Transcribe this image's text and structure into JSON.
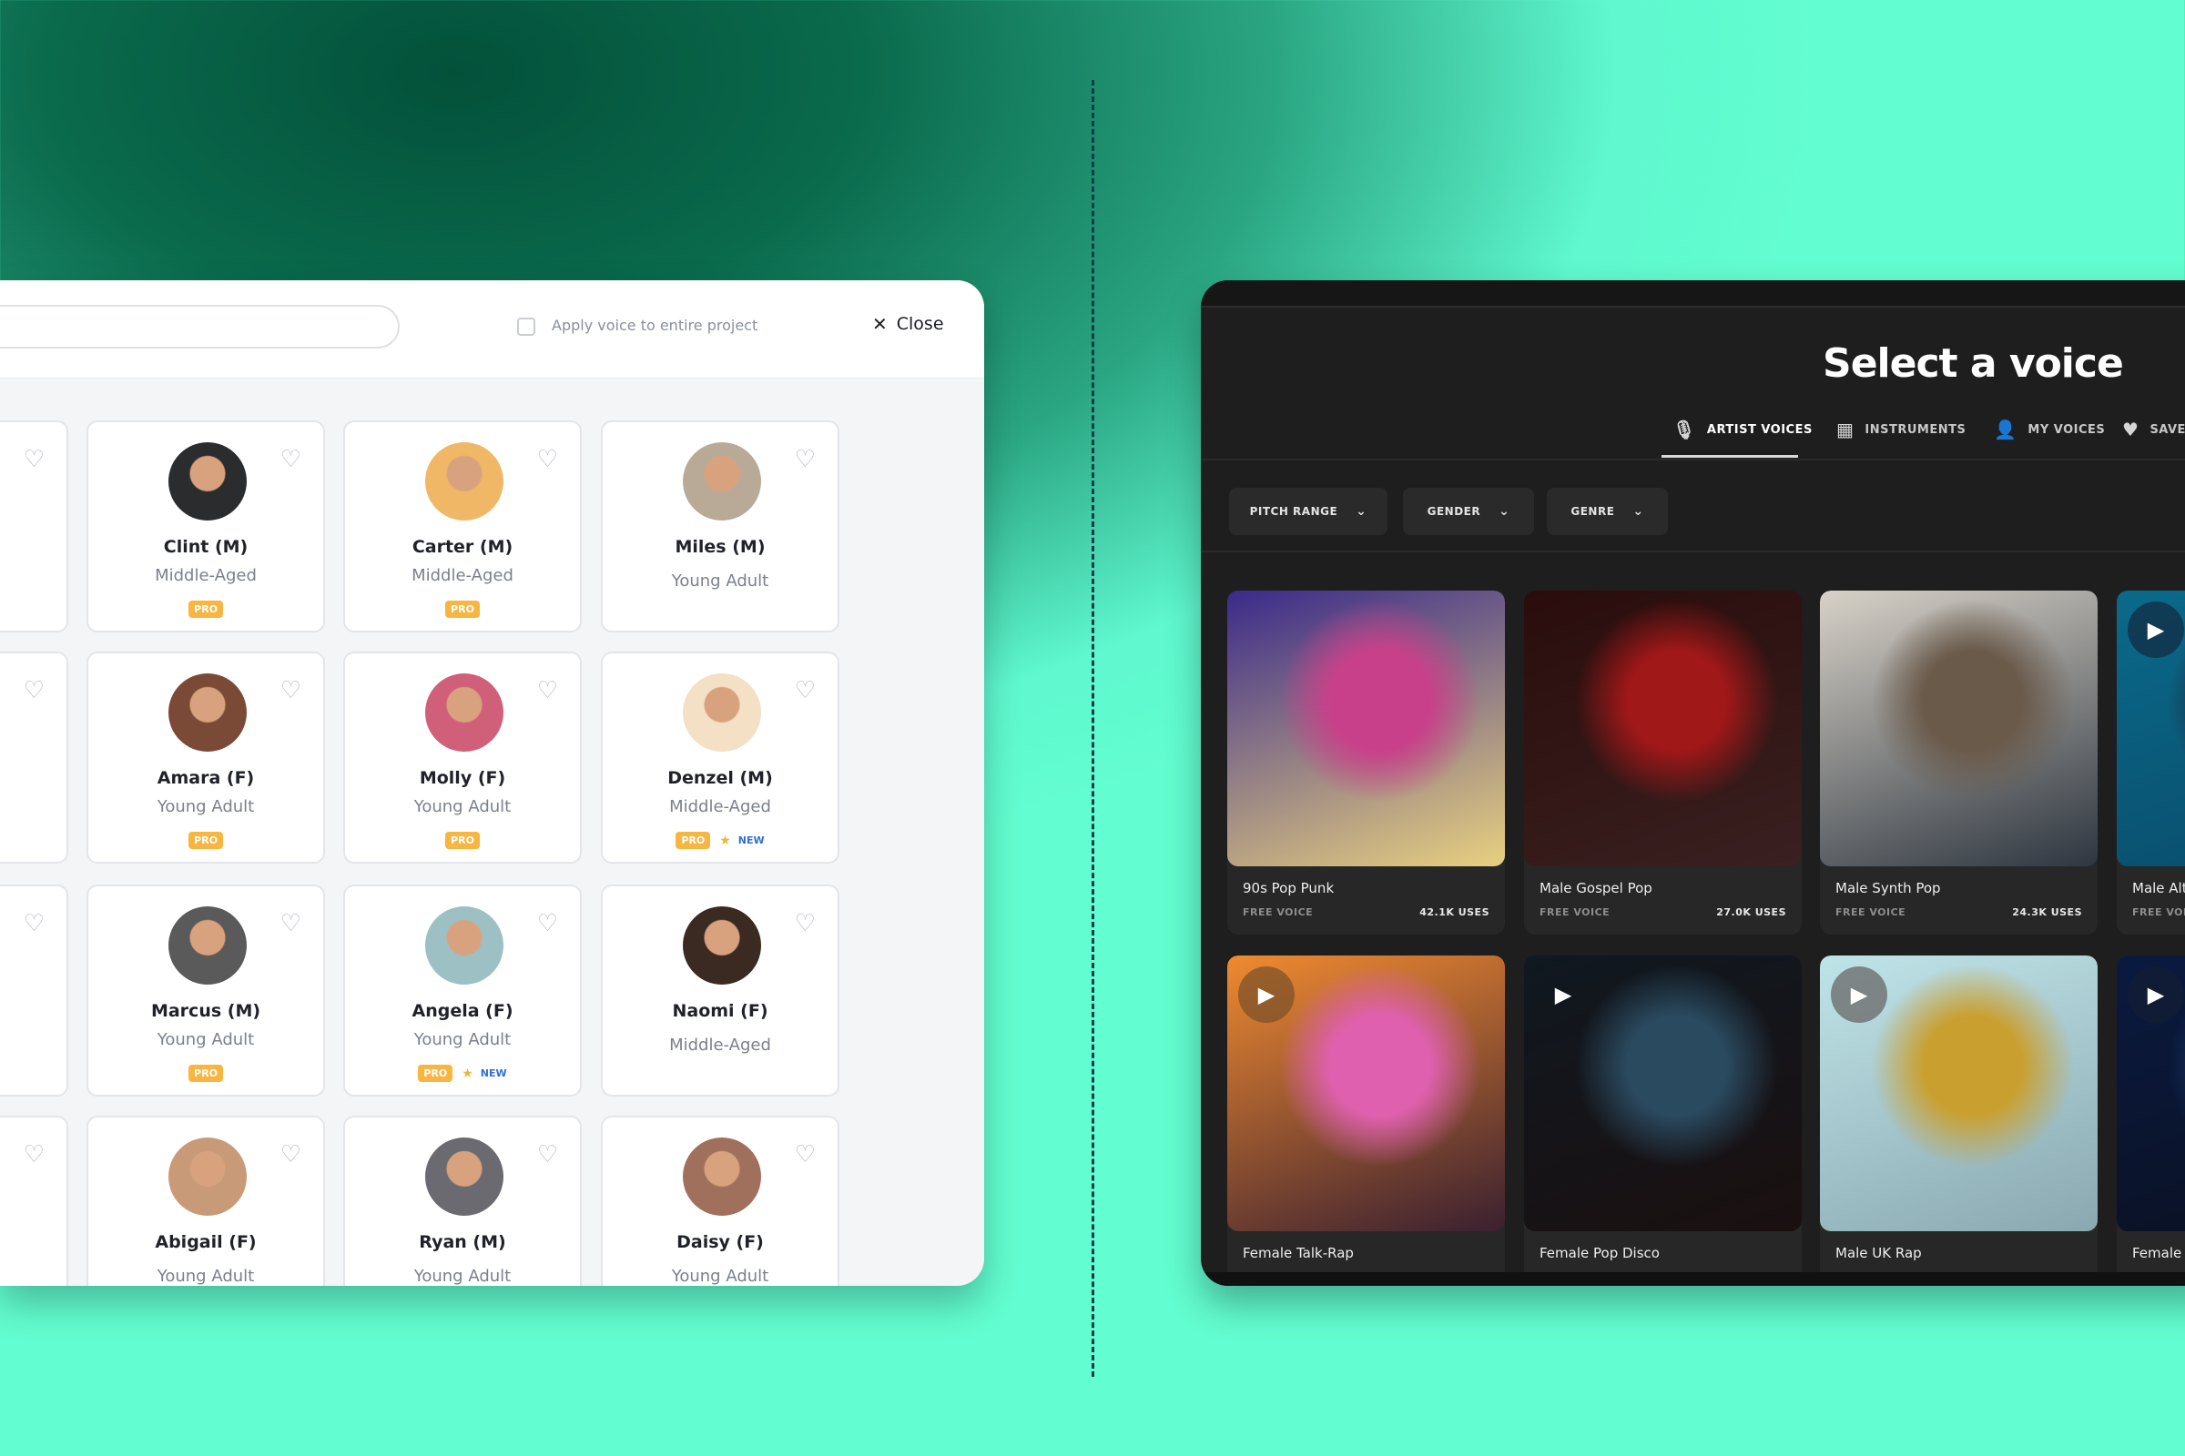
{
  "left_panel": {
    "apply_label": "Apply voice to entire project",
    "close_label": "Close",
    "voices": [
      {
        "name": "Clint (M)",
        "age": "Middle-Aged",
        "pro": "PRO",
        "color": "#2a2c2e"
      },
      {
        "name": "Carter (M)",
        "age": "Middle-Aged",
        "pro": "PRO",
        "color": "#f0b766"
      },
      {
        "name": "Miles (M)",
        "age": "Young Adult",
        "color": "#b9aa98"
      },
      {
        "name": "Amara (F)",
        "age": "Young Adult",
        "pro": "PRO",
        "color": "#7a4a36"
      },
      {
        "name": "Molly (F)",
        "age": "Young Adult",
        "pro": "PRO",
        "color": "#d0607a"
      },
      {
        "name": "Denzel (M)",
        "age": "Middle-Aged",
        "pro": "PRO",
        "new": "NEW",
        "color": "#f4e0c4"
      },
      {
        "name": "Marcus (M)",
        "age": "Young Adult",
        "pro": "PRO",
        "color": "#5a5a5a"
      },
      {
        "name": "Angela (F)",
        "age": "Young Adult",
        "pro": "PRO",
        "new": "NEW",
        "color": "#9cc0c4"
      },
      {
        "name": "Naomi (F)",
        "age": "Middle-Aged",
        "color": "#3a2a22"
      },
      {
        "name": "Abigail (F)",
        "age": "Young Adult",
        "color": "#c89a78"
      },
      {
        "name": "Ryan (M)",
        "age": "Young Adult",
        "color": "#6a6a70"
      },
      {
        "name": "Daisy (F)",
        "age": "Young Adult",
        "color": "#a0705c"
      }
    ]
  },
  "right_panel": {
    "title": "Select a voice",
    "tabs": [
      {
        "label": "ARTIST VOICES",
        "icon": "microphone-icon",
        "active": true
      },
      {
        "label": "INSTRUMENTS",
        "icon": "piano-icon"
      },
      {
        "label": "MY VOICES",
        "icon": "user-icon"
      },
      {
        "label": "SAVED",
        "icon": "heart-icon"
      }
    ],
    "filters": [
      "PITCH RANGE",
      "GENDER",
      "GENRE"
    ],
    "voices": [
      {
        "title": "90s Pop Punk",
        "tag": "FREE VOICE",
        "uses": "42.1K USES",
        "colors": [
          "#3a2a8a",
          "#c9408a",
          "#e8d080"
        ]
      },
      {
        "title": "Male Gospel Pop",
        "tag": "FREE VOICE",
        "uses": "27.0K USES",
        "colors": [
          "#2a0c0c",
          "#a01818",
          "#3a2020"
        ]
      },
      {
        "title": "Male Synth Pop",
        "tag": "FREE VOICE",
        "uses": "24.3K USES",
        "colors": [
          "#d8d2c8",
          "#6a5a4a",
          "#2e3640"
        ]
      },
      {
        "title": "Male Alt",
        "tag": "FREE VOICE",
        "uses": "",
        "colors": [
          "#0a6a8a",
          "#1a2a40",
          "#0a4a6a"
        ],
        "play": true
      },
      {
        "title": "Female Talk-Rap",
        "colors": [
          "#f08a30",
          "#e060b0",
          "#3a2030"
        ],
        "play": true
      },
      {
        "title": "Female Pop Disco",
        "colors": [
          "#101820",
          "#2a4a60",
          "#1a1010"
        ],
        "play": true
      },
      {
        "title": "Male UK Rap",
        "colors": [
          "#bfe4e8",
          "#c9a030",
          "#8aa8b0"
        ],
        "play": true
      },
      {
        "title": "Female",
        "colors": [
          "#0a1a40",
          "#1a3a70",
          "#0a1020"
        ],
        "play": true
      }
    ]
  }
}
